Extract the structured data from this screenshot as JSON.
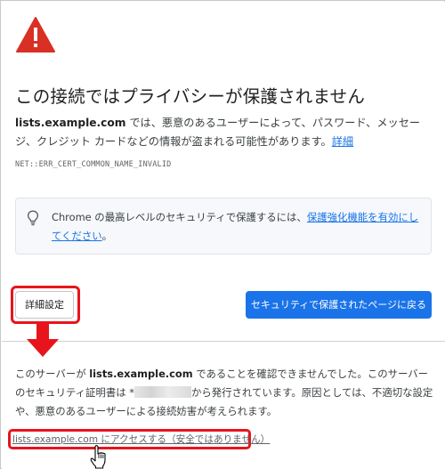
{
  "page": {
    "title": "この接続ではプライバシーが保護されません",
    "domain": "lists.example.com",
    "description_part1": "では、悪意のあるユーザーによって、パスワード、メッセージ、クレジット カードなどの情報が盗まれる可能性があります。",
    "details_link": "詳細",
    "error_code": "NET::ERR_CERT_COMMON_NAME_INVALID"
  },
  "protection": {
    "text": "Chrome の最高レベルのセキュリティで保護するには、",
    "link": "保護強化機能を有効にしてください",
    "suffix": "。"
  },
  "buttons": {
    "advanced": "詳細設定",
    "back": "セキュリティで保護されたページに戻る"
  },
  "details": {
    "prefix": "このサーバーが",
    "domain": "lists.example.com",
    "text1": "であることを確認できませんでした。このサーバーのセキュリティ証明書は",
    "issuer_prefix": "*",
    "text2": "から発行されています。原因としては、不適切な設定や、悪意のあるユーザーによる接続妨害が考えられます。",
    "proceed_link": "lists.example.com にアクセスする（安全ではありません）"
  },
  "colors": {
    "accent_blue": "#1a73e8",
    "highlight_red": "#e8141c",
    "warning_red": "#d93025"
  },
  "icons": {
    "warning": "warning-triangle-icon",
    "bulb": "lightbulb-icon",
    "arrow": "down-arrow-icon",
    "cursor": "hand-pointer-icon"
  }
}
